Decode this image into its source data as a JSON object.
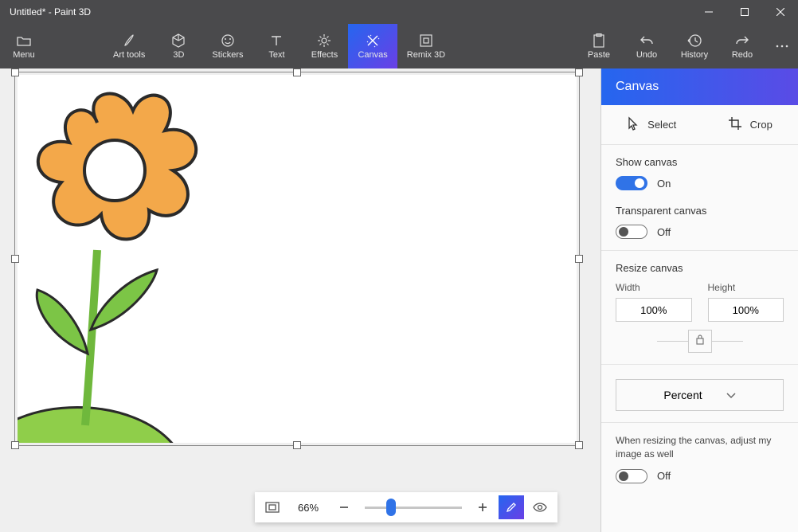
{
  "title": "Untitled* - Paint 3D",
  "toolbar": {
    "menu": "Menu",
    "art_tools": "Art tools",
    "three_d": "3D",
    "stickers": "Stickers",
    "text": "Text",
    "effects": "Effects",
    "canvas": "Canvas",
    "remix": "Remix 3D",
    "paste": "Paste",
    "undo": "Undo",
    "history": "History",
    "redo": "Redo"
  },
  "zoom": {
    "value": "66%",
    "thumb_pct": 22
  },
  "panel": {
    "header": "Canvas",
    "select": "Select",
    "crop": "Crop",
    "show_canvas": "Show canvas",
    "show_canvas_state": "On",
    "transparent_canvas": "Transparent canvas",
    "transparent_state": "Off",
    "resize": "Resize canvas",
    "width_label": "Width",
    "height_label": "Height",
    "width_val": "100%",
    "height_val": "100%",
    "unit": "Percent",
    "hint": "When resizing the canvas, adjust my image as well",
    "hint_state": "Off"
  }
}
